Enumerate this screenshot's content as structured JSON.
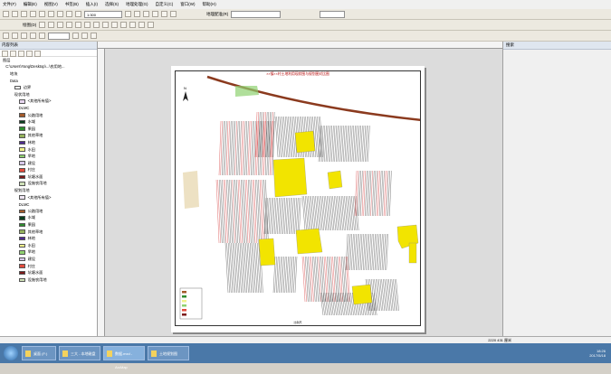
{
  "menu": [
    "文件(F)",
    "编辑(E)",
    "视图(V)",
    "书签(B)",
    "插入(I)",
    "选择(S)",
    "地理处理(G)",
    "自定义(C)",
    "窗口(W)",
    "帮助(H)"
  ],
  "toolbar": {
    "scale": "1:300",
    "georef_label": "地理配准(R)",
    "draw_label": "绘图(D)"
  },
  "toc": {
    "title": "内容列表",
    "rows": [
      {
        "label": "图层",
        "indent": 0,
        "swatch": ""
      },
      {
        "label": "C:\\Users\\Yang\\Desktop\\...\\农用地...",
        "indent": 2,
        "swatch": ""
      },
      {
        "label": "地块",
        "indent": 5,
        "swatch": ""
      },
      {
        "label": "Data",
        "indent": 5,
        "swatch": ""
      },
      {
        "label": "边界",
        "indent": 8,
        "swatch": "#ffffff"
      },
      {
        "label": "现状用地",
        "indent": 8,
        "swatch": ""
      },
      {
        "label": "<其他所有值>",
        "indent": 11,
        "swatch": "#e7d6ef"
      },
      {
        "label": "DLMC",
        "indent": 11,
        "swatch": ""
      },
      {
        "label": "公路用地",
        "indent": 11,
        "swatch": "#a35a2a"
      },
      {
        "label": "水域",
        "indent": 11,
        "swatch": "#0b3f1f"
      },
      {
        "label": "果园",
        "indent": 11,
        "swatch": "#2f8d2f"
      },
      {
        "label": "其他草地",
        "indent": 11,
        "swatch": "#94b25c"
      },
      {
        "label": "林地",
        "indent": 11,
        "swatch": "#4f2c8f"
      },
      {
        "label": "水田",
        "indent": 11,
        "swatch": "#f0f28a"
      },
      {
        "label": "旱地",
        "indent": 11,
        "swatch": "#8fd170"
      },
      {
        "label": "建设",
        "indent": 11,
        "swatch": "#d7c8ea"
      },
      {
        "label": "村庄",
        "indent": 11,
        "swatch": "#e34c3d"
      },
      {
        "label": "坑塘水面",
        "indent": 11,
        "swatch": "#7c1a1a"
      },
      {
        "label": "设施农用地",
        "indent": 11,
        "swatch": "#cfe1b8"
      },
      {
        "label": "规划用地",
        "indent": 8,
        "swatch": ""
      },
      {
        "label": "<其他所有值>",
        "indent": 11,
        "swatch": "#f0e6f4"
      },
      {
        "label": "DLMC",
        "indent": 11,
        "swatch": ""
      },
      {
        "label": "公路用地",
        "indent": 11,
        "swatch": "#a35a2a"
      },
      {
        "label": "水域",
        "indent": 11,
        "swatch": "#0b3f1f"
      },
      {
        "label": "果园",
        "indent": 11,
        "swatch": "#2f8d2f"
      },
      {
        "label": "其他草地",
        "indent": 11,
        "swatch": "#94b25c"
      },
      {
        "label": "林地",
        "indent": 11,
        "swatch": "#4f2c8f"
      },
      {
        "label": "水田",
        "indent": 11,
        "swatch": "#f0f28a"
      },
      {
        "label": "旱地",
        "indent": 11,
        "swatch": "#8fd170"
      },
      {
        "label": "建设",
        "indent": 11,
        "swatch": "#d7c8ea"
      },
      {
        "label": "村庄",
        "indent": 11,
        "swatch": "#e34c3d"
      },
      {
        "label": "坑塘水面",
        "indent": 11,
        "swatch": "#7c1a1a"
      },
      {
        "label": "设施农用地",
        "indent": 11,
        "swatch": "#cfe1b8"
      }
    ]
  },
  "map": {
    "title": "××镇××村土地利用现状图与规划图对比图",
    "north": "N",
    "bottom_label": "比例尺"
  },
  "right_panel": {
    "title": "搜索"
  },
  "status": "2220  431  厘米",
  "taskbar": {
    "items": [
      {
        "label": "桌面 (F:)",
        "active": false
      },
      {
        "label": "三大 - 本地磁盘",
        "active": false
      },
      {
        "label": "数据.mxd - ArcMap",
        "active": true
      },
      {
        "label": "土地规划图",
        "active": false
      }
    ],
    "time": "18:26",
    "date": "2017/5/18"
  },
  "colors": {
    "road": "#8b3a1e",
    "village": "#f2e400",
    "farm_lines": "#444444",
    "red_lines": "#d23030"
  }
}
